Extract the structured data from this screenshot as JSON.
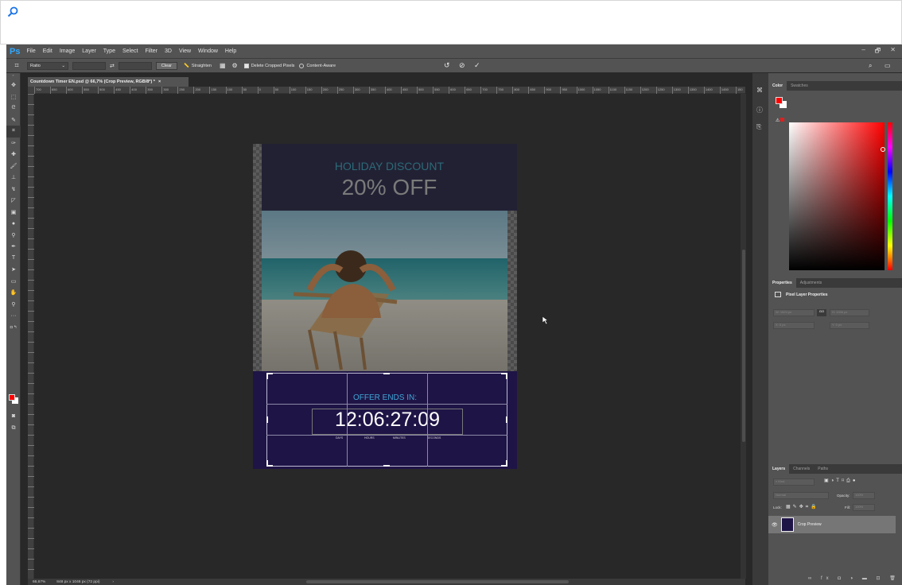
{
  "app": {
    "logo": "Ps",
    "menus": [
      "File",
      "Edit",
      "Image",
      "Layer",
      "Type",
      "Select",
      "Filter",
      "3D",
      "View",
      "Window",
      "Help"
    ],
    "window_controls": [
      "–",
      "🗗",
      "✕"
    ]
  },
  "options_bar": {
    "ratio": "Ratio",
    "swap": "⇄",
    "clear": "Clear",
    "straighten": "Straighten",
    "delete_cropped": "Delete Cropped Pixels",
    "content_aware": "Content-Aware",
    "delete_cropped_checked": true,
    "content_aware_checked": false
  },
  "document": {
    "tab_title": "Countdown Timer EN.psd @ 66,7% (Crop Preview, RGB/8*) *",
    "tab_close": "×",
    "ruler_labels": [
      "700",
      "650",
      "600",
      "550",
      "500",
      "450",
      "400",
      "350",
      "300",
      "250",
      "200",
      "150",
      "100",
      "50",
      "0",
      "50",
      "100",
      "150",
      "200",
      "250",
      "300",
      "350",
      "400",
      "450",
      "500",
      "550",
      "600",
      "650",
      "700",
      "750",
      "800",
      "850",
      "900",
      "950",
      "1000",
      "1050",
      "1100",
      "1150",
      "1200",
      "1250",
      "1300",
      "1350",
      "1400",
      "1450",
      "150"
    ]
  },
  "canvas": {
    "banner_line1": "HOLIDAY DISCOUNT",
    "banner_line2": "20% OFF",
    "offer_text": "OFFER ENDS IN:",
    "timer": "12:06:27:09",
    "units": [
      "DAYS",
      "HOURS",
      "MINUTES",
      "SECONDS"
    ]
  },
  "status": {
    "zoom": "66,67%",
    "doc_size": "848 px x 1046 px (72 ppi)",
    "arrow": "›"
  },
  "panels": {
    "color_tabs": [
      "Color",
      "Swatches"
    ],
    "properties_tabs": [
      "Properties",
      "Adjustments"
    ],
    "properties_title": "Pixel Layer Properties",
    "prop_w": "W: 1524 px",
    "prop_h": "H: 1946 px",
    "prop_x": "X: 0 px",
    "prop_y": "Y: 0 px",
    "prop_link": "GO",
    "layers_tabs": [
      "Layers",
      "Channels",
      "Paths"
    ],
    "kind": "Kind",
    "blend_mode": "Normal",
    "opacity_label": "Opacity:",
    "opacity_value": "100%",
    "lock_label": "Lock:",
    "fill_label": "Fill:",
    "fill_value": "100%",
    "layer_name": "Crop Preview"
  },
  "colors": {
    "foreground": "#ff0000",
    "background": "#ffffff",
    "accent_blue": "#31a8ff",
    "timer_bg": "#1f1446"
  }
}
